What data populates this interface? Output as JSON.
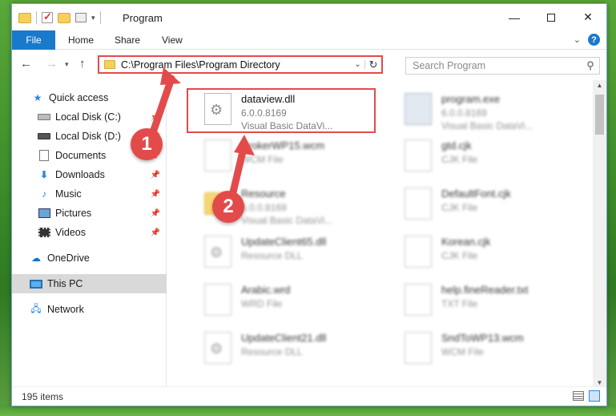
{
  "window": {
    "title": "Program",
    "controls": {
      "minimize": "—",
      "maximize": "",
      "close": "✕"
    }
  },
  "ribbon": {
    "tabs": [
      "File",
      "Home",
      "Share",
      "View"
    ],
    "help": "?"
  },
  "nav": {
    "back": "←",
    "forward": "→",
    "recent": "⌄",
    "up": "↑"
  },
  "address": {
    "path": "C:\\Program Files\\Program Directory",
    "refresh": "↻",
    "dropdown": "⌄"
  },
  "search": {
    "placeholder": "Search Program",
    "icon": "🔍"
  },
  "sidebar": {
    "items": [
      {
        "label": "Quick access",
        "icon": "star-icon"
      },
      {
        "label": "Local Disk (C:)",
        "icon": "drive-icon",
        "pinned": true
      },
      {
        "label": "Local Disk (D:)",
        "icon": "drive-icon",
        "pinned": true
      },
      {
        "label": "Documents",
        "icon": "documents-icon",
        "pinned": true
      },
      {
        "label": "Downloads",
        "icon": "download-icon",
        "pinned": true
      },
      {
        "label": "Music",
        "icon": "music-icon",
        "pinned": true
      },
      {
        "label": "Pictures",
        "icon": "pictures-icon",
        "pinned": true
      },
      {
        "label": "Videos",
        "icon": "videos-icon",
        "pinned": true
      },
      {
        "label": "OneDrive",
        "icon": "cloud-icon"
      },
      {
        "label": "This PC",
        "icon": "computer-icon",
        "selected": true
      },
      {
        "label": "Network",
        "icon": "network-icon"
      }
    ]
  },
  "files": [
    {
      "name": "dataview.dll",
      "meta1": "6.0.0.8169",
      "meta2": "Visual Basic DataVi...",
      "icon": "dll-icon",
      "highlighted": true
    },
    {
      "name": "program.exe",
      "meta1": "6.0.0.8169",
      "meta2": "Visual Basic DataVi...",
      "icon": "exe-icon"
    },
    {
      "name": "BrokerWP15.wcm",
      "meta1": "WCM File",
      "meta2": "",
      "icon": "file-icon"
    },
    {
      "name": "gtd.cjk",
      "meta1": "CJK File",
      "meta2": "",
      "icon": "file-icon"
    },
    {
      "name": "Resource",
      "meta1": "6.0.0.8169",
      "meta2": "Visual Basic DataVi...",
      "icon": "folder-icon"
    },
    {
      "name": "DefaultFont.cjk",
      "meta1": "CJK File",
      "meta2": "",
      "icon": "file-icon"
    },
    {
      "name": "UpdateClient65.dll",
      "meta1": "Resource DLL",
      "meta2": "",
      "icon": "dll-icon"
    },
    {
      "name": "Korean.cjk",
      "meta1": "CJK File",
      "meta2": "",
      "icon": "file-icon"
    },
    {
      "name": "Arabic.wrd",
      "meta1": "WRD File",
      "meta2": "",
      "icon": "file-icon"
    },
    {
      "name": "help.fineReader.txt",
      "meta1": "TXT File",
      "meta2": "",
      "icon": "file-icon"
    },
    {
      "name": "UpdateClient21.dll",
      "meta1": "Resource DLL",
      "meta2": "",
      "icon": "dll-icon"
    },
    {
      "name": "SndToWP13.wcm",
      "meta1": "WCM File",
      "meta2": "",
      "icon": "file-icon"
    }
  ],
  "status": {
    "count": "195 items"
  },
  "annotations": {
    "marker1": "1",
    "marker2": "2"
  },
  "colors": {
    "accent": "#1979ca",
    "highlight": "#e34b4b"
  }
}
